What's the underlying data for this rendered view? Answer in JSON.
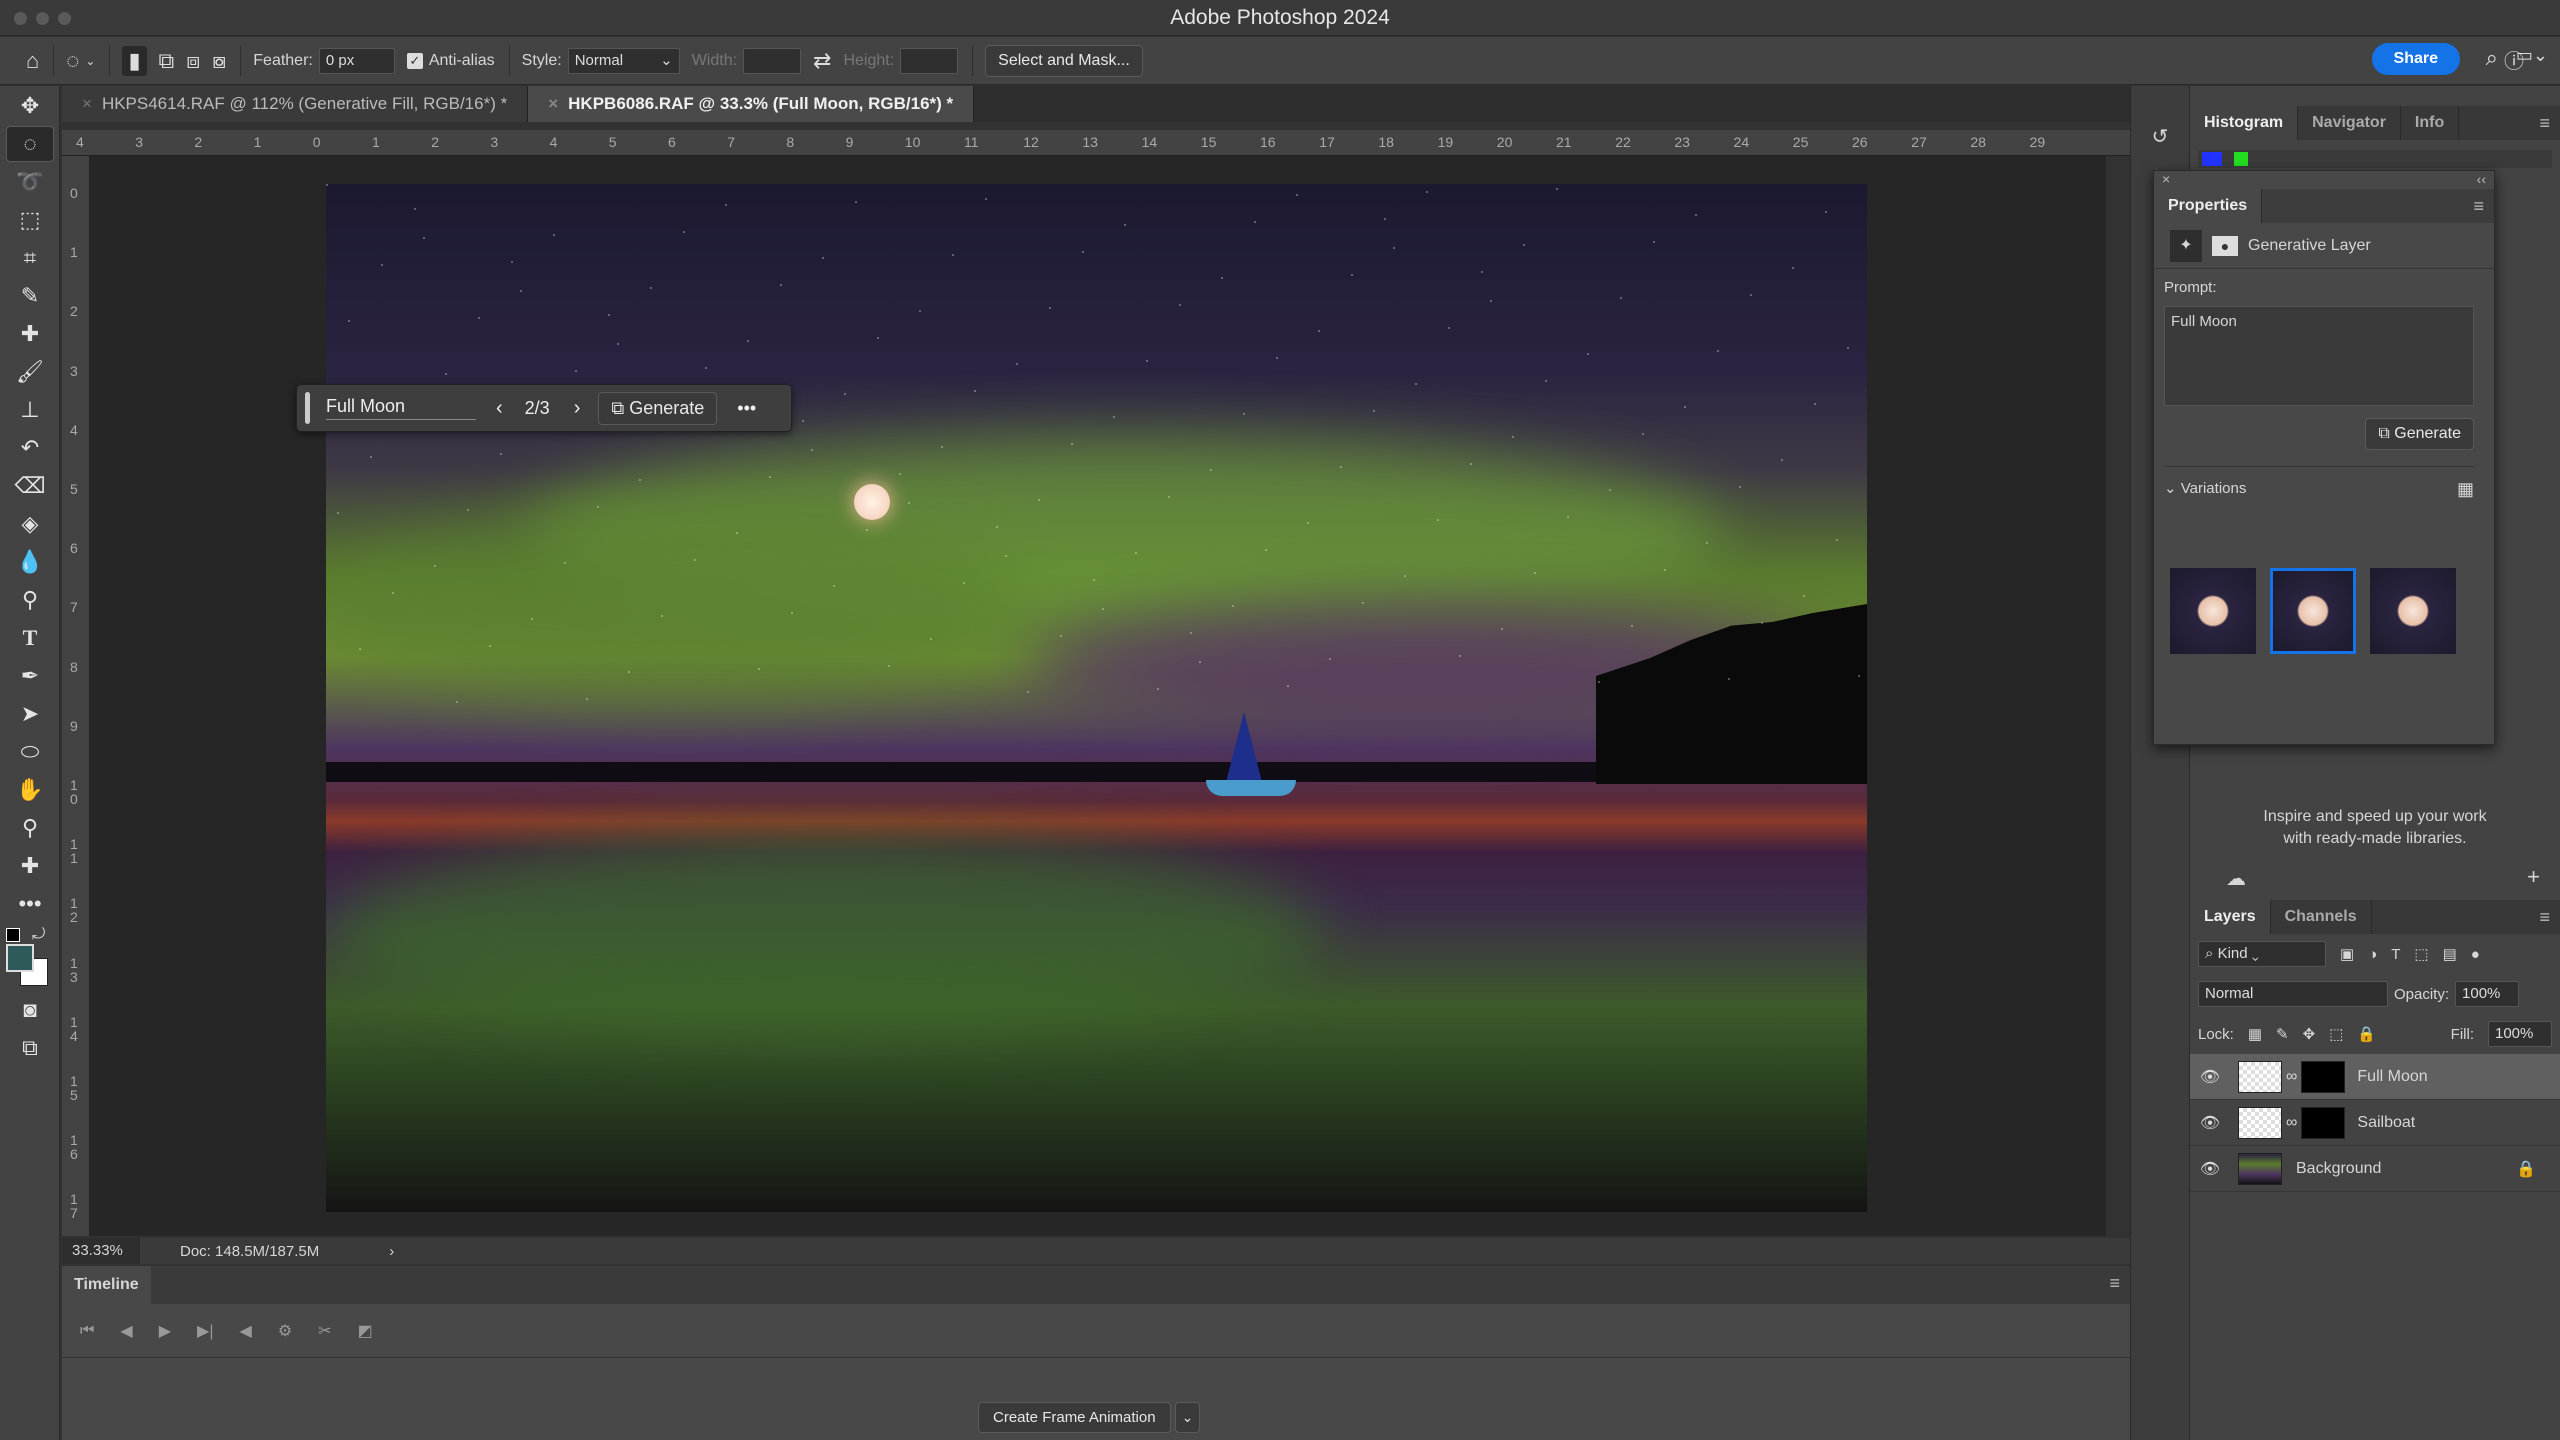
{
  "app": {
    "title": "Adobe Photoshop 2024"
  },
  "options": {
    "feather_label": "Feather:",
    "feather_value": "0 px",
    "antialias_label": "Anti-alias",
    "antialias_checked": true,
    "style_label": "Style:",
    "style_value": "Normal",
    "width_label": "Width:",
    "height_label": "Height:",
    "select_mask": "Select and Mask...",
    "share": "Share"
  },
  "tabs": [
    {
      "label": "HKPS4614.RAF @ 112% (Generative Fill, RGB/16*) *",
      "active": false
    },
    {
      "label": "HKPB6086.RAF @ 33.3% (Full Moon, RGB/16*) *",
      "active": true
    }
  ],
  "rulers": {
    "horizontal": [
      "4",
      "3",
      "2",
      "1",
      "0",
      "1",
      "2",
      "3",
      "4",
      "5",
      "6",
      "7",
      "8",
      "9",
      "10",
      "11",
      "12",
      "13",
      "14",
      "15",
      "16",
      "17",
      "18",
      "19",
      "20",
      "21",
      "22",
      "23",
      "24",
      "25",
      "26",
      "27",
      "28",
      "29"
    ],
    "vertical": [
      "0",
      "1",
      "2",
      "3",
      "4",
      "5",
      "6",
      "7",
      "8",
      "9",
      "10",
      "11",
      "12",
      "13",
      "14",
      "15",
      "16",
      "17"
    ]
  },
  "genbar": {
    "prompt": "Full Moon",
    "counter": "2/3",
    "generate": "Generate"
  },
  "status": {
    "zoom": "33.33%",
    "doc": "Doc: 148.5M/187.5M"
  },
  "timeline": {
    "title": "Timeline",
    "create": "Create Frame Animation"
  },
  "right_tabs": [
    "Histogram",
    "Navigator",
    "Info"
  ],
  "properties": {
    "title": "Properties",
    "layer_type": "Generative Layer",
    "prompt_label": "Prompt:",
    "prompt_value": "Full Moon",
    "generate": "Generate",
    "variations": "Variations",
    "variation_count": 3,
    "selected_variation": 2
  },
  "libraries": {
    "text1": "Inspire and speed up your work",
    "text2": "with ready-made libraries."
  },
  "layers_panel": {
    "tabs": [
      "Layers",
      "Channels"
    ],
    "filter": "Kind",
    "blend": "Normal",
    "opacity_label": "Opacity:",
    "opacity": "100%",
    "lock_label": "Lock:",
    "fill_label": "Fill:",
    "fill": "100%",
    "layers": [
      {
        "name": "Full Moon",
        "selected": true
      },
      {
        "name": "Sailboat",
        "selected": false
      },
      {
        "name": "Background",
        "selected": false,
        "locked": true
      }
    ]
  },
  "colors": {
    "accent": "#1473e6",
    "foreground": "#2f5a5a",
    "background": "#ffffff"
  }
}
